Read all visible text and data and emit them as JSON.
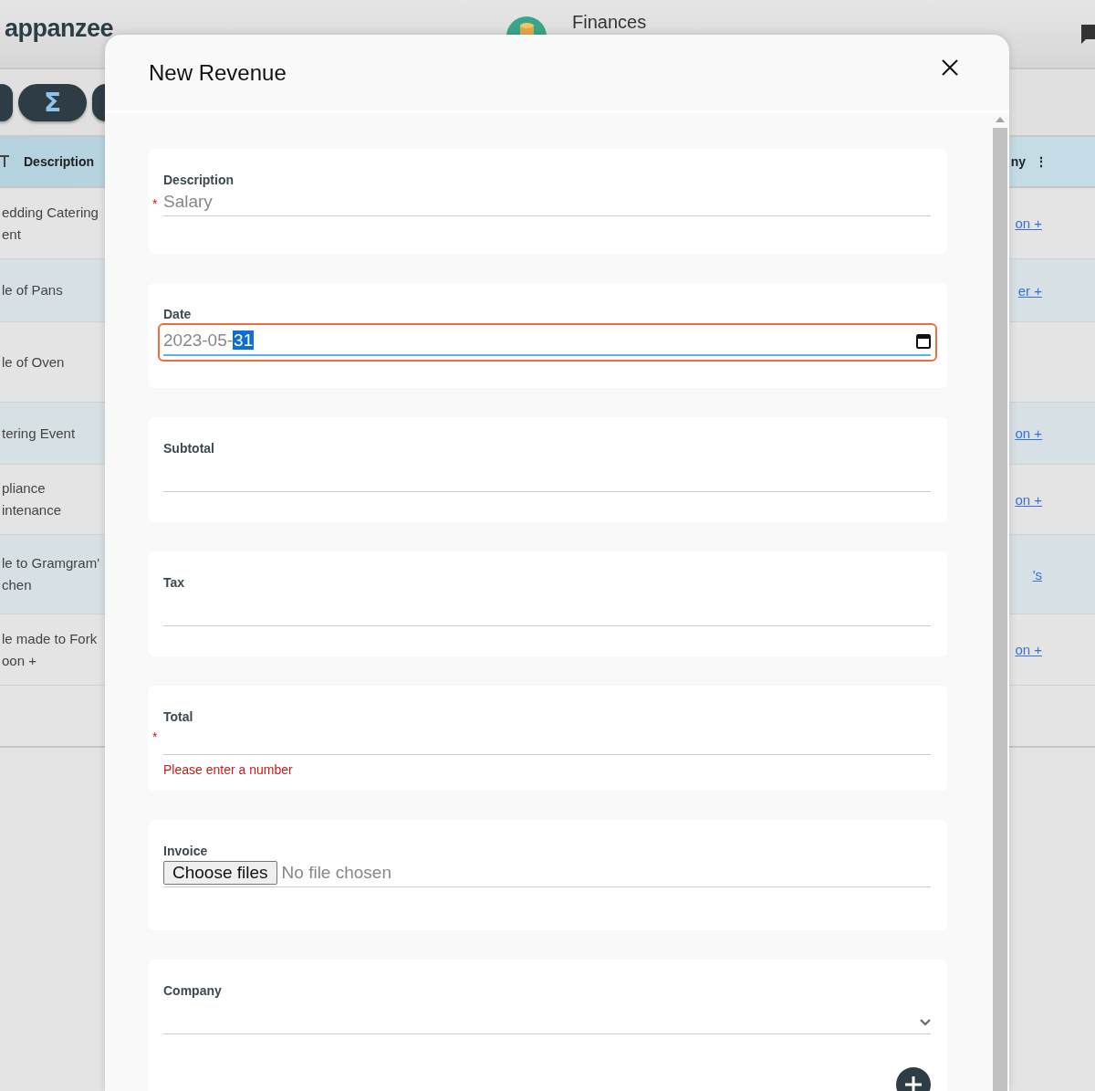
{
  "app": {
    "logo": "appanzee",
    "section_title": "Finances"
  },
  "toolbar": {
    "sum_button": "Σ"
  },
  "table": {
    "columns": [
      {
        "label": "Description"
      },
      {
        "label": "ny",
        "menu": "⋮"
      }
    ],
    "rows": [
      {
        "description": "edding Catering\nent",
        "company": "on +"
      },
      {
        "description": "le of Pans",
        "company": "er +"
      },
      {
        "description": "le of Oven"
      },
      {
        "description": "tering Event",
        "company": "on +"
      },
      {
        "description": "pliance\nintenance",
        "company": "on +"
      },
      {
        "description": "le to Gramgram'\nchen",
        "company": "'s"
      },
      {
        "description": "le made to Fork\noon +",
        "company": "on +"
      }
    ]
  },
  "modal": {
    "title": "New Revenue",
    "fields": [
      {
        "kind": "text",
        "label": "Description",
        "required_mark": "*",
        "placeholder": "Salary"
      },
      {
        "kind": "date",
        "label": "Date",
        "focused": true,
        "value_parts": [
          {
            "text": "2023-05-",
            "selected": false
          },
          {
            "text": "31",
            "selected": true
          }
        ]
      },
      {
        "kind": "text",
        "label": "Subtotal"
      },
      {
        "kind": "text",
        "label": "Tax"
      },
      {
        "kind": "text",
        "label": "Total",
        "required_mark": "*",
        "error": "Please enter a number"
      },
      {
        "kind": "file",
        "label": "Invoice",
        "button": "Choose files",
        "status": "No file chosen"
      },
      {
        "kind": "select",
        "label": "Company"
      }
    ]
  }
}
